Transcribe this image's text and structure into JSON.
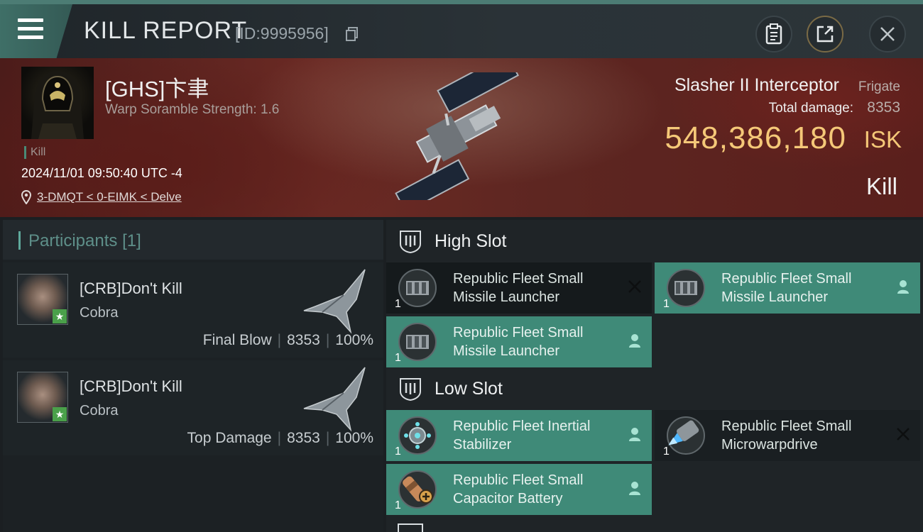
{
  "header": {
    "title": "KILL REPORT",
    "report_id": "[ID:9995956]"
  },
  "victim": {
    "name": "[GHS]卞聿",
    "subtitle": "Warp Soramble Strength: 1.6",
    "tag": "Kill",
    "time": "2024/11/01 09:50:40 UTC -4",
    "location": "3-DMQT < 0-EIMK < Delve",
    "ship_name": "Slasher II Interceptor",
    "ship_class": "Frigate",
    "damage_label": "Total damage:",
    "damage_value": "8353",
    "isk_value": "548,386,180",
    "isk_unit": "ISK",
    "result": "Kill"
  },
  "participants": {
    "title": "Participants",
    "count": "[1]",
    "rows": [
      {
        "name": "[CRB]Don't Kill",
        "ship": "Cobra",
        "role": "Final Blow",
        "damage": "8353",
        "percent": "100%"
      },
      {
        "name": "[CRB]Don't Kill",
        "ship": "Cobra",
        "role": "Top Damage",
        "damage": "8353",
        "percent": "100%"
      }
    ]
  },
  "fitting": {
    "high_slot": {
      "title": "High Slot",
      "modules": [
        {
          "name": "Republic Fleet Small Missile Launcher",
          "qty": "1",
          "icon": "missile-launcher-icon",
          "status": "destroyed"
        },
        {
          "name": "Republic Fleet Small Missile Launcher",
          "qty": "1",
          "icon": "missile-launcher-icon",
          "status": "dropped"
        },
        {
          "name": "Republic Fleet Small Missile Launcher",
          "qty": "1",
          "icon": "missile-launcher-icon",
          "status": "dropped"
        }
      ]
    },
    "low_slot": {
      "title": "Low Slot",
      "modules": [
        {
          "name": "Republic Fleet Inertial Stabilizer",
          "qty": "1",
          "icon": "inertial-stabilizer-icon",
          "status": "dropped"
        },
        {
          "name": "Republic Fleet Small Microwarpdrive",
          "qty": "1",
          "icon": "microwarpdrive-icon",
          "status": "destroyed"
        },
        {
          "name": "Republic Fleet Small Capacitor Battery",
          "qty": "1",
          "icon": "capacitor-battery-icon",
          "status": "dropped"
        }
      ]
    }
  },
  "colors": {
    "accent": "#3f8a78",
    "isk": "#f5c878",
    "header_bar": "#4c7c74"
  }
}
